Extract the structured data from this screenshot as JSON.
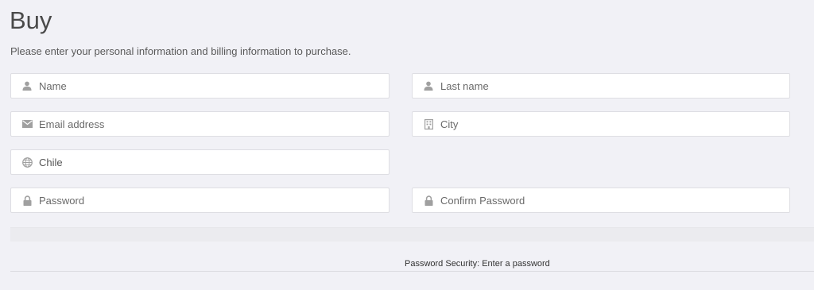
{
  "header": {
    "title": "Buy",
    "subtitle": "Please enter your personal information and billing information to purchase."
  },
  "form": {
    "name": {
      "placeholder": "Name",
      "value": "",
      "icon": "user-icon"
    },
    "last_name": {
      "placeholder": "Last name",
      "value": "",
      "icon": "user-icon"
    },
    "email": {
      "placeholder": "Email address",
      "value": "",
      "icon": "envelope-icon"
    },
    "city": {
      "placeholder": "City",
      "value": "",
      "icon": "building-icon"
    },
    "country": {
      "value": "Chile",
      "icon": "globe-icon"
    },
    "password": {
      "placeholder": "Password",
      "value": "",
      "icon": "lock-icon"
    },
    "confirm_password": {
      "placeholder": "Confirm Password",
      "value": "",
      "icon": "lock-icon"
    }
  },
  "password_security": {
    "label": "Password Security: Enter a password"
  },
  "colors": {
    "background": "#f1f1f6",
    "field_background": "#ffffff",
    "field_border": "#dedee3",
    "icon": "#a0a0a0"
  }
}
